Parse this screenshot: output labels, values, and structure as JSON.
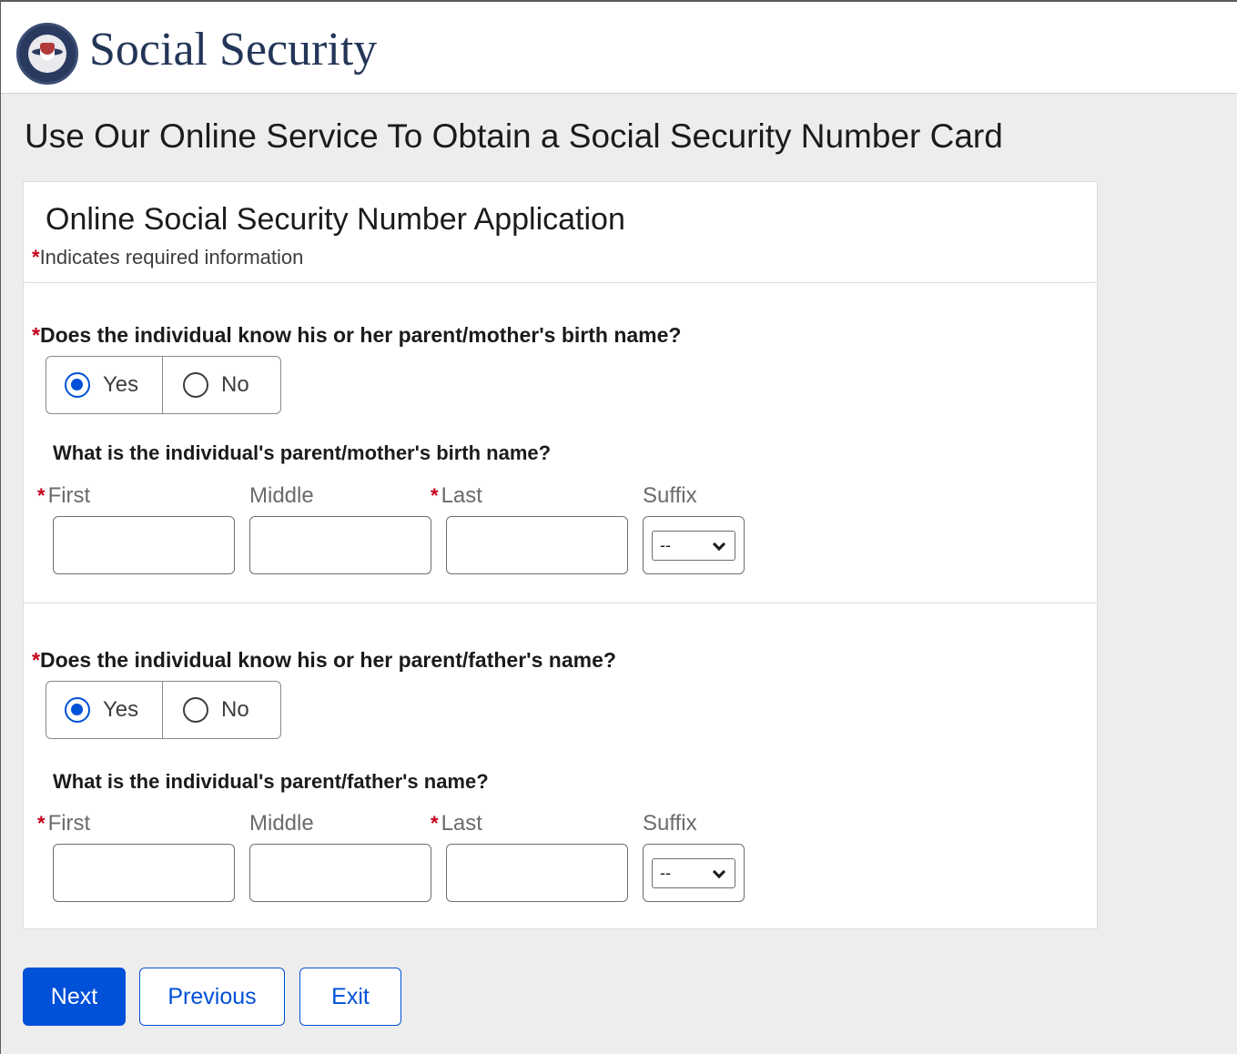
{
  "header": {
    "brand": "Social Security",
    "logo": "ssa-seal-icon"
  },
  "page_title": "Use Our Online Service To Obtain a Social Security Number Card",
  "card": {
    "title": "Online Social Security Number Application",
    "required_star": "*",
    "required_note": "Indicates required information"
  },
  "mother": {
    "question": "Does the individual know his or her parent/mother's birth name?",
    "yes_label": "Yes",
    "no_label": "No",
    "selected": "Yes",
    "name_question": "What is the individual's parent/mother's birth name?",
    "first_label": "First",
    "middle_label": "Middle",
    "last_label": "Last",
    "suffix_label": "Suffix",
    "first_value": "",
    "middle_value": "",
    "last_value": "",
    "suffix_value": "--"
  },
  "father": {
    "question": "Does the individual know his or her parent/father's name?",
    "yes_label": "Yes",
    "no_label": "No",
    "selected": "Yes",
    "name_question": "What is the individual's parent/father's name?",
    "first_label": "First",
    "middle_label": "Middle",
    "last_label": "Last",
    "suffix_label": "Suffix",
    "first_value": "",
    "middle_value": "",
    "last_value": "",
    "suffix_value": "--"
  },
  "buttons": {
    "next": "Next",
    "previous": "Previous",
    "exit": "Exit"
  },
  "colors": {
    "primary": "#0050d8",
    "brand_text": "#233658",
    "required_star": "#c4001a"
  }
}
